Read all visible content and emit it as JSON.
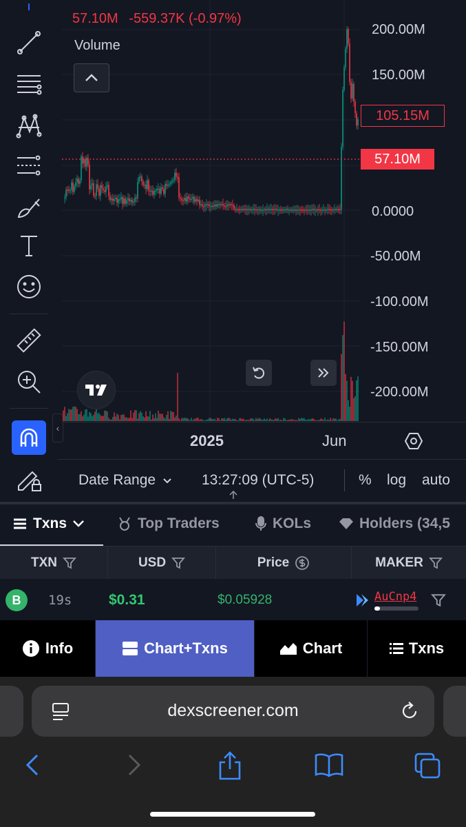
{
  "chart": {
    "legend_close": "57.10M",
    "legend_change": "-559.37K (-0.97%)",
    "volume_label": "Volume",
    "price_axis": [
      "200.00M",
      "150.00M",
      "105.15M",
      "57.10M",
      "0.0000",
      "-50.00M",
      "-100.00M",
      "-150.00M",
      "-200.00M"
    ],
    "last_price": "105.15M",
    "current_price": "57.10M",
    "time_labels": [
      "2025",
      "Jun"
    ],
    "colors": {
      "up": "#089981",
      "down": "#f23645",
      "accent": "#2962ff"
    }
  },
  "bottom_bar": {
    "date_range": "Date Range",
    "time": "13:27:09 (UTC-5)",
    "percent": "%",
    "log": "log",
    "auto": "auto"
  },
  "tabs": {
    "txns": "Txns",
    "top_traders": "Top Traders",
    "kols": "KOLs",
    "holders": "Holders (34,5"
  },
  "table": {
    "headers": [
      "TXN",
      "USD",
      "Price",
      "MAKER"
    ],
    "row": {
      "type": "B",
      "age": "19s",
      "usd": "$0.31",
      "price": "$0.05928",
      "maker": "AuCnp4"
    }
  },
  "nav": {
    "info": "Info",
    "chart_txns": "Chart+Txns",
    "chart": "Chart",
    "txns": "Txns"
  },
  "browser": {
    "url": "dexscreener.com"
  }
}
